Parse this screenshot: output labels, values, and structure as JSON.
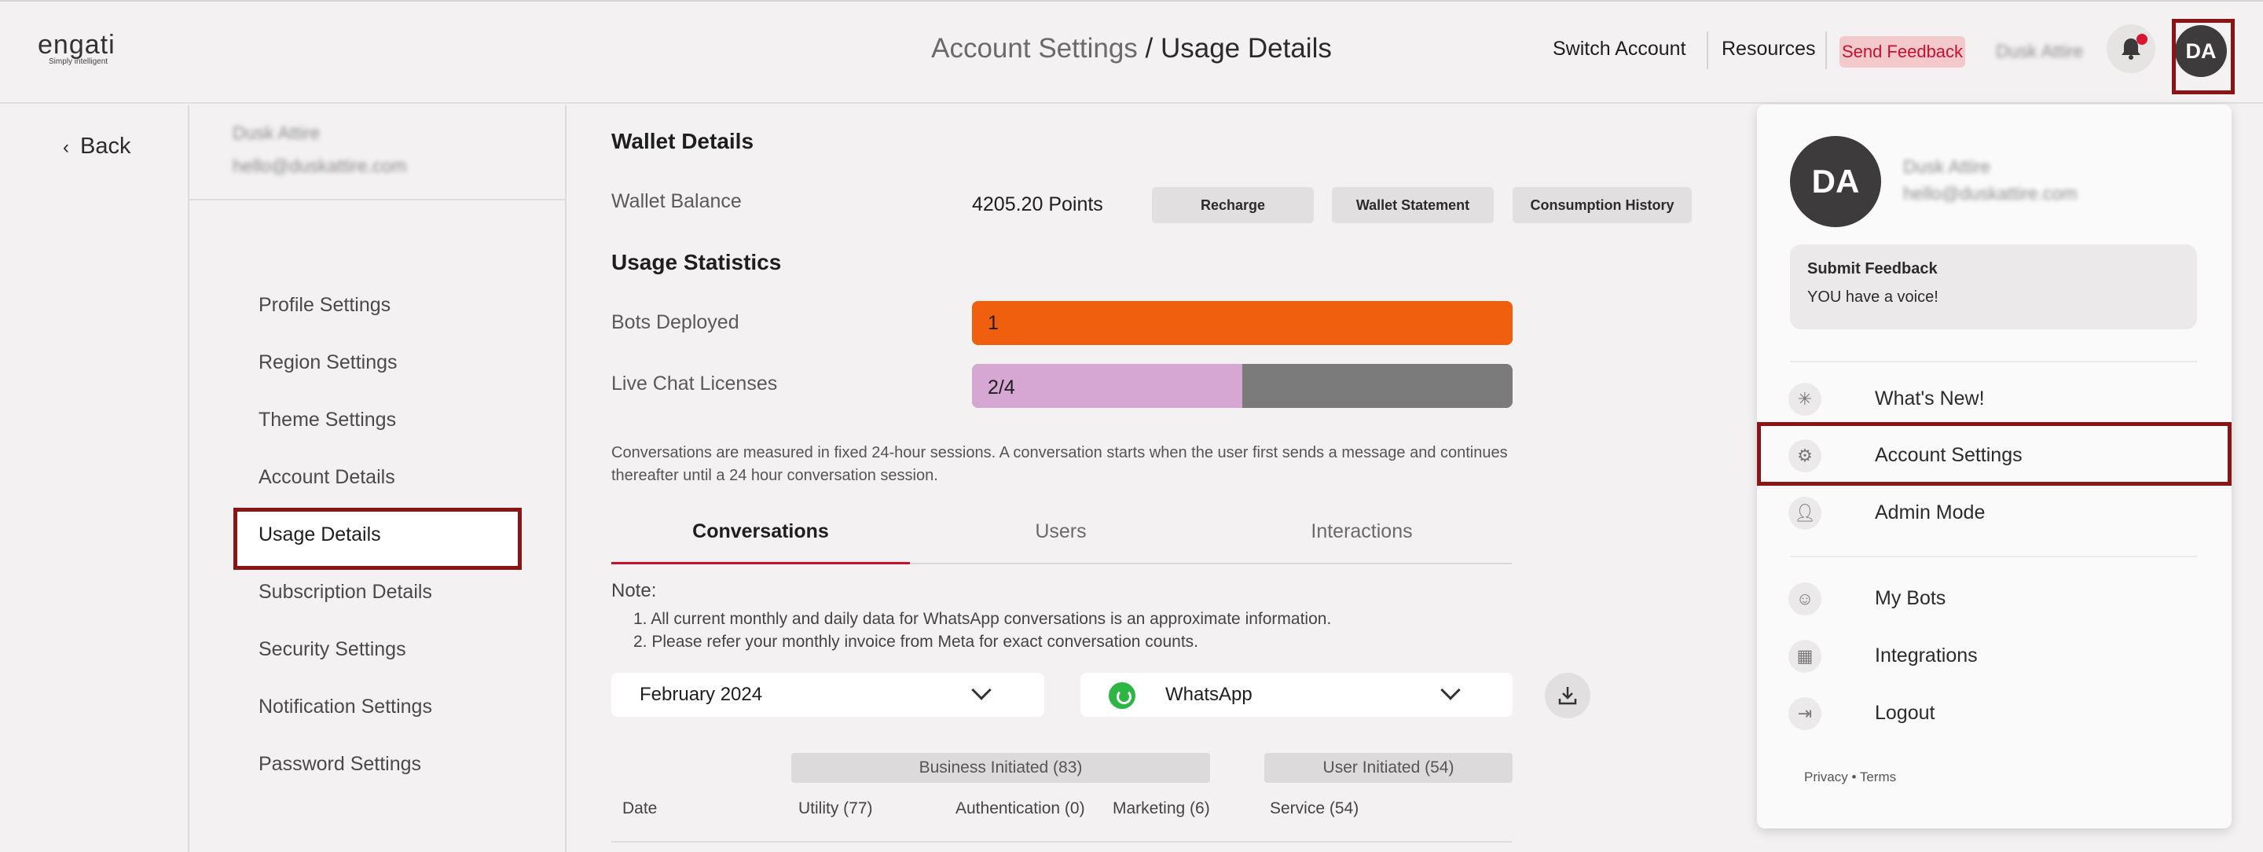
{
  "header": {
    "logo_text": "engati",
    "logo_tagline": "Simply intelligent",
    "title_parent": "Account Settings",
    "title_separator": " / ",
    "title_current": "Usage Details",
    "switch_account": "Switch Account",
    "resources": "Resources",
    "send_feedback": "Send Feedback",
    "user_name": "Dusk Attire",
    "avatar_initials": "DA",
    "accent_color": "#c8102e"
  },
  "nav": {
    "back": "Back",
    "account_name": "Dusk Attire",
    "account_email": "hello@duskattire.com",
    "items": [
      {
        "label": "Profile Settings"
      },
      {
        "label": "Region Settings"
      },
      {
        "label": "Theme Settings"
      },
      {
        "label": "Account Details"
      },
      {
        "label": "Usage Details",
        "active": true
      },
      {
        "label": "Subscription Details"
      },
      {
        "label": "Security Settings"
      },
      {
        "label": "Notification Settings"
      },
      {
        "label": "Password Settings"
      }
    ]
  },
  "wallet": {
    "title": "Wallet Details",
    "balance_label": "Wallet Balance",
    "balance_value": "4205.20 Points",
    "recharge": "Recharge",
    "statement": "Wallet Statement",
    "history": "Consumption History"
  },
  "usage": {
    "title": "Usage Statistics",
    "bots_label": "Bots Deployed",
    "bots_value": "1",
    "bots_fill": 1.0,
    "bots_color": "#ef5f0d",
    "chat_label": "Live Chat Licenses",
    "chat_value": "2/4",
    "chat_fill": 0.5,
    "chat_color": "#d7a7d4",
    "description": "Conversations are measured in fixed 24-hour sessions. A conversation starts when the user first sends a message and continues thereafter until a 24 hour conversation session."
  },
  "tabs": {
    "conversations": "Conversations",
    "users": "Users",
    "interactions": "Interactions"
  },
  "note": {
    "title": "Note:",
    "line1": "1. All current monthly and daily data for WhatsApp conversations is an approximate information.",
    "line2": "2. Please refer your monthly invoice from Meta for exact conversation counts."
  },
  "filters": {
    "month": "February 2024",
    "channel": "WhatsApp"
  },
  "table": {
    "business_group": "Business Initiated (83)",
    "user_group": "User Initiated (54)",
    "columns": [
      "Date",
      "Utility (77)",
      "Authentication (0)",
      "Marketing (6)",
      "Service (54)"
    ]
  },
  "dropdown": {
    "initials": "DA",
    "name": "Dusk Attire",
    "email": "hello@duskattire.com",
    "feedback_title": "Submit Feedback",
    "feedback_sub": "YOU have a voice!",
    "items": [
      {
        "label": "What's New!",
        "icon": "sparkle-icon"
      },
      {
        "label": "Account Settings",
        "icon": "gear-icon"
      },
      {
        "label": "Admin Mode",
        "icon": "user-icon"
      },
      {
        "label": "My Bots",
        "icon": "bot-icon"
      },
      {
        "label": "Integrations",
        "icon": "grid-icon"
      },
      {
        "label": "Logout",
        "icon": "logout-icon"
      }
    ],
    "privacy": "Privacy",
    "footer_sep": "•",
    "terms": "Terms"
  }
}
